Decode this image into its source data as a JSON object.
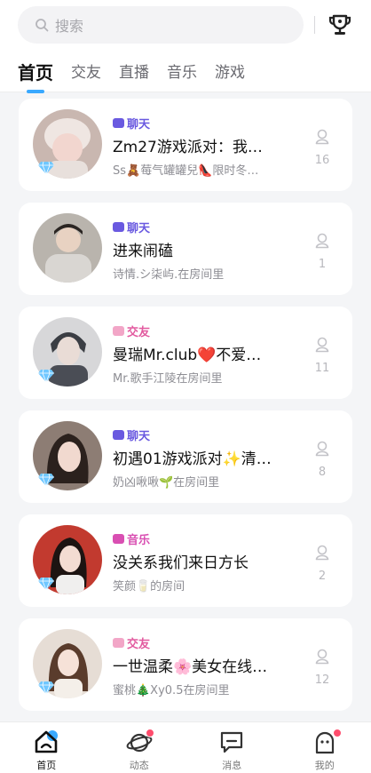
{
  "search": {
    "placeholder": "搜索",
    "icon": "search-icon"
  },
  "header": {
    "trophy_icon": "trophy-icon"
  },
  "tabs": [
    {
      "label": "首页",
      "active": true
    },
    {
      "label": "交友"
    },
    {
      "label": "直播"
    },
    {
      "label": "音乐"
    },
    {
      "label": "游戏"
    }
  ],
  "colors": {
    "chat": "#6a5ae0",
    "friend": "#e25a9f",
    "music": "#d94fb2",
    "accent": "#39a9ff",
    "badge": "#ff4d6d"
  },
  "rooms": [
    {
      "category": "聊天",
      "title": "Zm27游戏派对：我…",
      "subtitle": "Ss🧸莓气罐罐兒👠限时冬…",
      "count": "16"
    },
    {
      "category": "聊天",
      "title": "进来闹磕",
      "subtitle": "诗情.シ柒屿.在房间里",
      "count": "1"
    },
    {
      "category": "交友",
      "title": "曼瑞Mr.club❤️不爱…",
      "subtitle": "Mr.歌手江陵在房间里",
      "count": "11"
    },
    {
      "category": "聊天",
      "title": "初遇01游戏派对✨清…",
      "subtitle": "奶凶啾啾🌱在房间里",
      "count": "8"
    },
    {
      "category": "音乐",
      "title": "没关系我们来日方长",
      "subtitle": "笑颜🥛的房间",
      "count": "2"
    },
    {
      "category": "交友",
      "title": "一世温柔🌸美女在线…",
      "subtitle": "蜜桃🎄Xy0.5在房间里",
      "count": "12"
    }
  ],
  "bottom_nav": [
    {
      "label": "首页",
      "icon": "home-icon",
      "active": true
    },
    {
      "label": "动态",
      "icon": "planet-icon",
      "badge": true
    },
    {
      "label": "消息",
      "icon": "message-icon"
    },
    {
      "label": "我的",
      "icon": "profile-icon",
      "badge": true
    }
  ]
}
